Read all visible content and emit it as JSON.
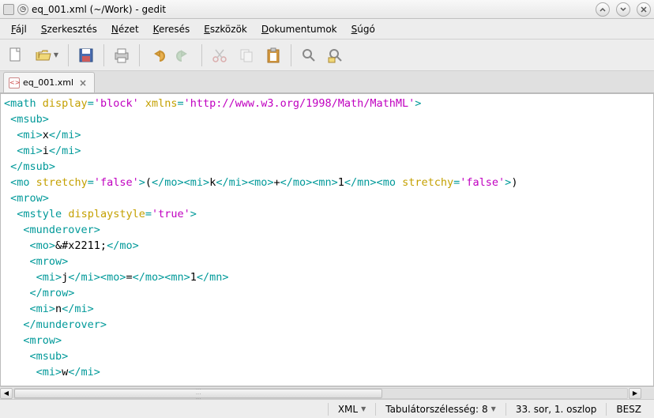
{
  "window": {
    "title": "eq_001.xml (~/Work) - gedit"
  },
  "menu": {
    "file": "Fájl",
    "edit": "Szerkesztés",
    "view": "Nézet",
    "search": "Keresés",
    "tools": "Eszközök",
    "documents": "Dokumentumok",
    "help": "Súgó"
  },
  "tab": {
    "filename": "eq_001.xml"
  },
  "code": {
    "lines": [
      [
        [
          "tag",
          "<math"
        ],
        [
          "text",
          " "
        ],
        [
          "attr",
          "display"
        ],
        [
          "tag",
          "="
        ],
        [
          "val",
          "'block'"
        ],
        [
          "text",
          " "
        ],
        [
          "attr",
          "xmlns"
        ],
        [
          "tag",
          "="
        ],
        [
          "val",
          "'http://www.w3.org/1998/Math/MathML'"
        ],
        [
          "tag",
          ">"
        ]
      ],
      [
        [
          "text",
          " "
        ],
        [
          "tag",
          "<msub>"
        ]
      ],
      [
        [
          "text",
          "  "
        ],
        [
          "tag",
          "<mi>"
        ],
        [
          "text",
          "x"
        ],
        [
          "tag",
          "</mi>"
        ]
      ],
      [
        [
          "text",
          "  "
        ],
        [
          "tag",
          "<mi>"
        ],
        [
          "text",
          "i"
        ],
        [
          "tag",
          "</mi>"
        ]
      ],
      [
        [
          "text",
          " "
        ],
        [
          "tag",
          "</msub>"
        ]
      ],
      [
        [
          "text",
          " "
        ],
        [
          "tag",
          "<mo"
        ],
        [
          "text",
          " "
        ],
        [
          "attr",
          "stretchy"
        ],
        [
          "tag",
          "="
        ],
        [
          "val",
          "'false'"
        ],
        [
          "tag",
          ">"
        ],
        [
          "text",
          "("
        ],
        [
          "tag",
          "</mo><mi>"
        ],
        [
          "text",
          "k"
        ],
        [
          "tag",
          "</mi><mo>"
        ],
        [
          "text",
          "+"
        ],
        [
          "tag",
          "</mo><mn>"
        ],
        [
          "text",
          "1"
        ],
        [
          "tag",
          "</mn><mo"
        ],
        [
          "text",
          " "
        ],
        [
          "attr",
          "stretchy"
        ],
        [
          "tag",
          "="
        ],
        [
          "val",
          "'false'"
        ],
        [
          "tag",
          ">"
        ],
        [
          "text",
          ")"
        ]
      ],
      [
        [
          "text",
          " "
        ],
        [
          "tag",
          "<mrow>"
        ]
      ],
      [
        [
          "text",
          "  "
        ],
        [
          "tag",
          "<mstyle"
        ],
        [
          "text",
          " "
        ],
        [
          "attr",
          "displaystyle"
        ],
        [
          "tag",
          "="
        ],
        [
          "val",
          "'true'"
        ],
        [
          "tag",
          ">"
        ]
      ],
      [
        [
          "text",
          "   "
        ],
        [
          "tag",
          "<munderover>"
        ]
      ],
      [
        [
          "text",
          "    "
        ],
        [
          "tag",
          "<mo>"
        ],
        [
          "text",
          "&#x2211;"
        ],
        [
          "tag",
          "</mo>"
        ]
      ],
      [
        [
          "text",
          "    "
        ],
        [
          "tag",
          "<mrow>"
        ]
      ],
      [
        [
          "text",
          "     "
        ],
        [
          "tag",
          "<mi>"
        ],
        [
          "text",
          "j"
        ],
        [
          "tag",
          "</mi><mo>"
        ],
        [
          "text",
          "="
        ],
        [
          "tag",
          "</mo><mn>"
        ],
        [
          "text",
          "1"
        ],
        [
          "tag",
          "</mn>"
        ]
      ],
      [
        [
          "text",
          "    "
        ],
        [
          "tag",
          "</mrow>"
        ]
      ],
      [
        [
          "text",
          "    "
        ],
        [
          "tag",
          "<mi>"
        ],
        [
          "text",
          "n"
        ],
        [
          "tag",
          "</mi>"
        ]
      ],
      [
        [
          "text",
          "   "
        ],
        [
          "tag",
          "</munderover>"
        ]
      ],
      [
        [
          "text",
          "   "
        ],
        [
          "tag",
          "<mrow>"
        ]
      ],
      [
        [
          "text",
          "    "
        ],
        [
          "tag",
          "<msub>"
        ]
      ],
      [
        [
          "text",
          "     "
        ],
        [
          "tag",
          "<mi>"
        ],
        [
          "text",
          "w"
        ],
        [
          "tag",
          "</mi>"
        ]
      ]
    ]
  },
  "status": {
    "language": "XML",
    "tabwidth_label": "Tabulátorszélesség:",
    "tabwidth_value": "8",
    "position": "33. sor, 1. oszlop",
    "insert_mode": "BESZ"
  },
  "icons": {
    "new": "new-file-icon",
    "open": "open-folder-icon",
    "save": "save-disk-icon",
    "print": "print-icon",
    "undo": "undo-icon",
    "redo": "redo-icon",
    "cut": "cut-icon",
    "copy": "copy-icon",
    "paste": "paste-icon",
    "find": "find-icon",
    "replace": "replace-icon"
  }
}
